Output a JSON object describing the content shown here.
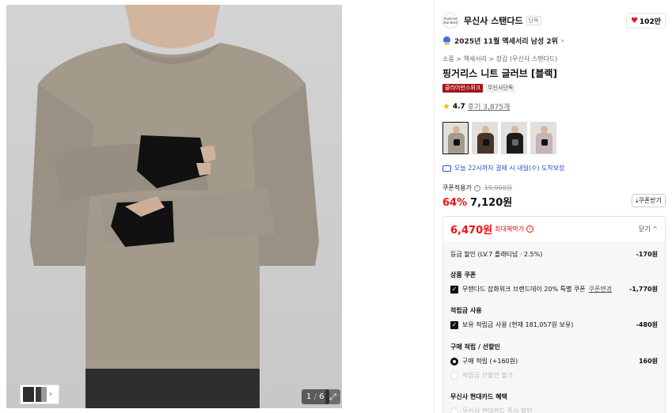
{
  "gallery": {
    "counter_current": "1",
    "counter_sep": "/",
    "counter_total": "6"
  },
  "brand": {
    "logo_line1": "musinsa",
    "logo_line2": "standard",
    "name": "무신사 스탠다드",
    "badge": "단독",
    "likes": "102만"
  },
  "ranking": {
    "text": "2025년 11월 액세서리 남성 2위"
  },
  "breadcrumb": "소품 > 액세서리 > 장갑 (무신사 스탠다드)",
  "product": {
    "title": "핑거리스 니트 글러브 [블랙]",
    "tag_event": "클리어런스위크",
    "tag_exclusive": "무신사단독",
    "rating": "4.7",
    "reviews": "후기 3,875개"
  },
  "delivery": "오늘 22시까지 결제 시 내일(수) 도착보장",
  "price": {
    "coupon_label": "쿠폰적용가",
    "original": "19,900원",
    "discount": "64%",
    "final": "7,120원",
    "coupon_button": "쿠폰받기"
  },
  "benefit": {
    "max_price": "6,470원",
    "max_label": "최대혜택가",
    "close": "닫기 ^",
    "grade_label": "등급 할인 (LV.7 플래티넘 · 2.5%)",
    "grade_amount": "-170원",
    "product_coupon_title": "상품 쿠폰",
    "coupon_label": "무탠다드 잡화위크 브랜드데이 20% 특별 쿠폰",
    "coupon_change": "쿠폰변경",
    "coupon_amount": "-1,770원",
    "points_title": "적립금 사용",
    "points_label": "보유 적립금 사용 (현재 181,057원 보유)",
    "points_amount": "-480원",
    "purchase_title": "구매 적립 / 선할인",
    "purchase_label": "구매 적립 (+160원)",
    "purchase_amount": "160원",
    "prediscount_label": "적립금 선할인 불가",
    "card_title": "무신사 현대카드 혜택",
    "card_label": "무신사 현대카드 즉시 할인"
  },
  "colors": {
    "accent_red": "#f31110",
    "delivery_blue": "#2750c9",
    "tag_red": "#a3151a"
  }
}
